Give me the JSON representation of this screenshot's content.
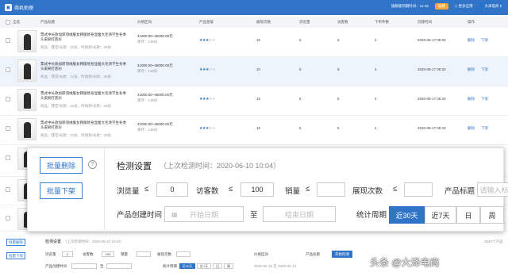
{
  "app": {
    "title": "商机助理",
    "logo_glyph": "▣"
  },
  "header": {
    "account_info": "旗舰版到期时间：11-25",
    "vip": "续费",
    "menu1": "◇ 更多应用",
    "menu2": "👤 大泽电商 ▾"
  },
  "table": {
    "columns": [
      "全选",
      "产品标题",
      "价格区间",
      "产品星级",
      "展现次数",
      "浏览量",
      "访客数",
      "下单件数",
      "创建时间",
      "操作"
    ],
    "rows": [
      {
        "title": "票式中长款加厚羽绒服女韩版修身显瘦大毛领学生冬季头皮刷打底衫",
        "tags": "商品：镂空/长款：21份，时尚款/长款：25份",
        "price": "41000.00~45000.00元",
        "stock": "库存：136份",
        "stars": 3,
        "views": "10",
        "pv": "5",
        "uv": "5",
        "orders": "4",
        "date": "2020-06-17 09:33",
        "edit": "删除",
        "down": "下架",
        "hl": false
      },
      {
        "title": "票式中长款加厚羽绒服女韩版修身显瘦大毛领学生冬季头皮刷打底衫",
        "tags": "商品：镂空/长款：21份，时尚款/长款：25份",
        "price": "41000.00~45000.00元",
        "stock": "库存：136份",
        "stars": 3,
        "views": "10",
        "pv": "5",
        "uv": "5",
        "orders": "4",
        "date": "2020-06-17 09:33",
        "edit": "删除",
        "down": "下架",
        "hl": true
      },
      {
        "title": "票式中长款加厚羽绒服女韩版修身显瘦大毛领学生冬季头皮刷打底衫",
        "tags": "商品：镂空/长款：21份，时尚款/长款：25份",
        "price": "41000.00~45000.00元",
        "stock": "库存：136份",
        "stars": 3,
        "views": "10",
        "pv": "5",
        "uv": "5",
        "orders": "4",
        "date": "2020-06-17 09:33",
        "edit": "删除",
        "down": "下架",
        "hl": false
      },
      {
        "title": "票式中长款加厚羽绒服女韩版修身显瘦大毛领学生冬季头皮刷打底衫",
        "tags": "商品：镂空/长款：21份，时尚款/长款：25份",
        "price": "41000.00~45000.00元",
        "stock": "库存：136份",
        "stars": 3,
        "views": "10",
        "pv": "5",
        "uv": "5",
        "orders": "4",
        "date": "2020-06-17 09:33",
        "edit": "删除",
        "down": "下架",
        "hl": false
      }
    ]
  },
  "detect": {
    "batch_delete": "批量删除",
    "batch_offline": "批量下架",
    "help": "?",
    "title": "检测设置",
    "last_check": "（上次检测时间：2020-06-10 10:04）",
    "pv_label": "浏览量",
    "lte": "≤",
    "pv_value": "0",
    "uv_label": "访客数",
    "uv_value": "100",
    "sales_label": "销量",
    "sales_value": "",
    "show_label": "展现次数",
    "show_value": "",
    "title_label": "产品标题",
    "title_placeholder": "请输入标题",
    "created_label": "产品创建时间",
    "start_placeholder": "开始日期",
    "to": "至",
    "end_placeholder": "结束日期",
    "period_label": "统计周期",
    "periods": [
      "近30天",
      "近7天",
      "日",
      "周"
    ],
    "period_active": 0
  },
  "bottom": {
    "batch_delete": "批量删除",
    "batch_offline": "批量下架",
    "title": "检测设置",
    "last_check": "（上次检测时间：2020-06-10 10:04）",
    "right_note": "3520个产品",
    "pv": "浏览量",
    "pv_v": "0",
    "uv": "访客数",
    "uv_v": "100",
    "sales": "销量",
    "show": "展现次数",
    "price": "价格区间",
    "ptitle": "产品标题",
    "run": "开始检测",
    "created": "产品创建时间",
    "to": "至",
    "period": "统计周期",
    "periods": [
      "近30天",
      "近7天",
      "日",
      "周"
    ],
    "date_range": "2020-05-18 至 2020-06-14"
  },
  "watermark": "头条 @大泽电商"
}
